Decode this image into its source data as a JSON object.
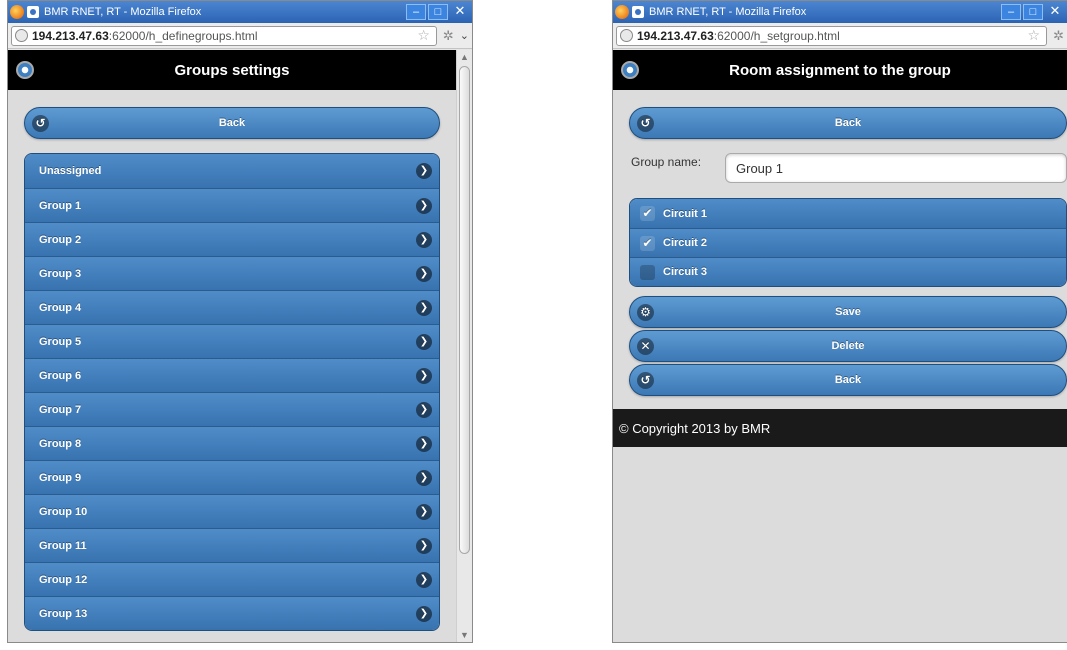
{
  "left_window": {
    "title": "BMR RNET, RT - Mozilla Firefox",
    "url_host": "194.213.47.63",
    "url_rest": ":62000/h_definegroups.html",
    "header_title": "Groups settings",
    "back_label": "Back",
    "groups": [
      "Unassigned",
      "Group 1",
      "Group 2",
      "Group 3",
      "Group 4",
      "Group 5",
      "Group 6",
      "Group 7",
      "Group 8",
      "Group 9",
      "Group 10",
      "Group 11",
      "Group 12",
      "Group 13"
    ]
  },
  "right_window": {
    "title": "BMR RNET, RT - Mozilla Firefox",
    "url_host": "194.213.47.63",
    "url_rest": ":62000/h_setgroup.html",
    "header_title": "Room assignment to the group",
    "back_label": "Back",
    "group_name_label": "Group name:",
    "group_name_value": "Group 1",
    "circuits": [
      {
        "label": "Circuit 1",
        "checked": true
      },
      {
        "label": "Circuit 2",
        "checked": true
      },
      {
        "label": "Circuit 3",
        "checked": false
      }
    ],
    "save_label": "Save",
    "delete_label": "Delete",
    "back2_label": "Back",
    "footer_text": "© Copyright 2013 by BMR"
  },
  "colors": {
    "button_blue": "#3b78b5",
    "header_black": "#000000",
    "page_bg": "#dcdcdc"
  }
}
